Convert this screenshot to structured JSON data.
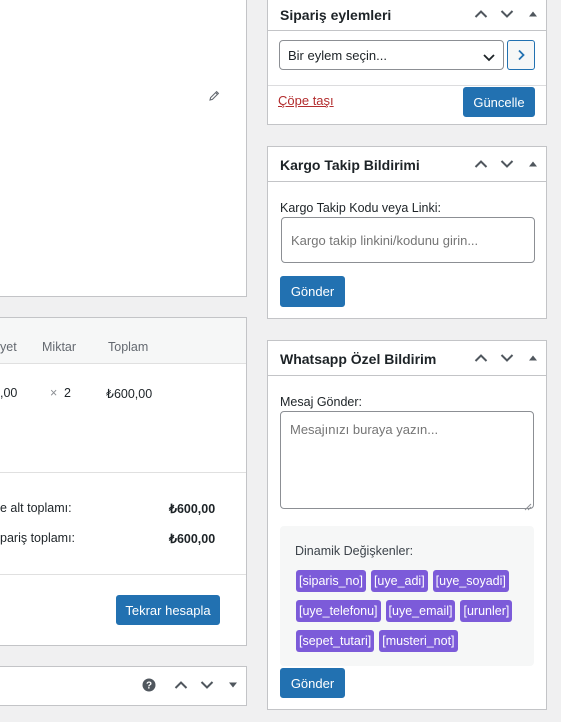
{
  "order_actions": {
    "title": "Sipariş eylemleri",
    "select_value": "Bir eylem seçin...",
    "trash_label": "Çöpe taşı",
    "update_label": "Güncelle"
  },
  "cargo": {
    "title": "Kargo Takip Bildirimi",
    "field_label": "Kargo Takip Kodu veya Linki:",
    "placeholder": "Kargo takip linkini/kodunu girin...",
    "send_label": "Gönder"
  },
  "whatsapp": {
    "title": "Whatsapp Özel Bildirim",
    "field_label": "Mesaj Gönder:",
    "placeholder": "Mesajınızı buraya yazın...",
    "vars_title": "Dinamik Değişkenler:",
    "tags": [
      "[siparis_no]",
      "[uye_adi]",
      "[uye_soyadi]",
      "[uye_telefonu]",
      "[uye_email]",
      "[urunler]",
      "[sepet_tutari]",
      "[musteri_not]"
    ],
    "send_label": "Gönder"
  },
  "items": {
    "headers": {
      "cost": "yet",
      "qty": "Miktar",
      "total": "Toplam"
    },
    "row": {
      "cost": ",00",
      "qty_sign": "×",
      "qty": "2",
      "total": "₺600,00"
    },
    "subtotal_label": "e alt toplamı:",
    "subtotal_value": "₺600,00",
    "order_total_label": "pariş toplamı:",
    "order_total_value": "₺600,00",
    "recalc_label": "Tekrar hesapla"
  },
  "colors": {
    "primary": "#2271b1",
    "tag": "#7c5bd9",
    "trash": "#b32d2e"
  }
}
